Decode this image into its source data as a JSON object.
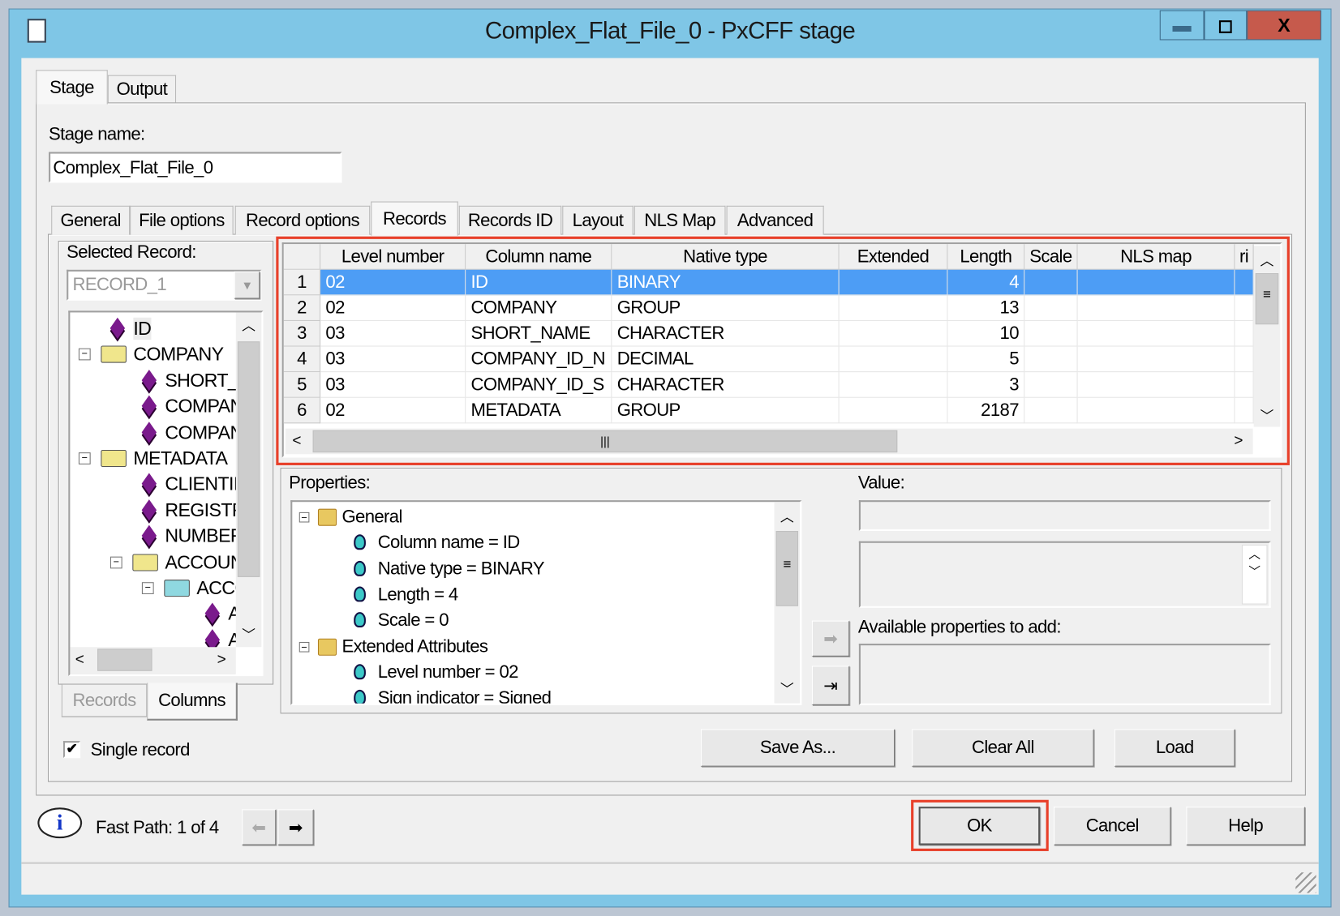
{
  "window": {
    "title": "Complex_Flat_File_0 - PxCFF stage",
    "minimize": "▬",
    "maximize": "◻",
    "close": "X"
  },
  "top_tabs": [
    {
      "label": "Stage",
      "selected": true
    },
    {
      "label": "Output",
      "selected": false
    }
  ],
  "stage_name": {
    "label": "Stage name:",
    "value": "Complex_Flat_File_0"
  },
  "inner_tabs": [
    {
      "label": "General"
    },
    {
      "label": "File options"
    },
    {
      "label": "Record options"
    },
    {
      "label": "Records",
      "selected": true
    },
    {
      "label": "Records ID"
    },
    {
      "label": "Layout"
    },
    {
      "label": "NLS Map"
    },
    {
      "label": "Advanced"
    }
  ],
  "left": {
    "selected_record_label": "Selected Record:",
    "selected_record_value": "RECORD_1",
    "tree": [
      {
        "label": "ID",
        "level": 0,
        "icon": "column-diamond-icon"
      },
      {
        "label": "COMPANY",
        "level": 0,
        "icon": "folder-icon",
        "expanded": true
      },
      {
        "label": "SHORT_",
        "level": 1,
        "icon": "column-diamond-icon"
      },
      {
        "label": "COMPAN",
        "level": 1,
        "icon": "column-diamond-icon"
      },
      {
        "label": "COMPAN",
        "level": 1,
        "icon": "column-diamond-icon"
      },
      {
        "label": "METADATA",
        "level": 0,
        "icon": "folder-icon",
        "expanded": true
      },
      {
        "label": "CLIENTII",
        "level": 1,
        "icon": "column-diamond-icon"
      },
      {
        "label": "REGISTF",
        "level": 1,
        "icon": "column-diamond-icon"
      },
      {
        "label": "NUMBEF",
        "level": 1,
        "icon": "column-diamond-icon"
      },
      {
        "label": "ACCOUN",
        "level": 1,
        "icon": "folder-icon",
        "expanded": true
      },
      {
        "label": "ACCC",
        "level": 2,
        "icon": "folder-cyan-icon",
        "expanded": true
      },
      {
        "label": "A",
        "level": 3,
        "icon": "column-diamond-icon"
      },
      {
        "label": "A",
        "level": 3,
        "icon": "column-diamond-icon"
      }
    ],
    "bottom_tabs": [
      {
        "label": "Records",
        "selected": false
      },
      {
        "label": "Columns",
        "selected": true
      }
    ],
    "single_record": {
      "label": "Single record",
      "checked": true
    }
  },
  "grid": {
    "columns": [
      "Level number",
      "Column name",
      "Native type",
      "Extended",
      "Length",
      "Scale",
      "NLS map",
      "ri"
    ],
    "rows": [
      {
        "n": "1",
        "level": "02",
        "name": "ID",
        "type": "BINARY",
        "extended": "",
        "length": "4",
        "scale": "",
        "nls": "",
        "selected": true
      },
      {
        "n": "2",
        "level": "02",
        "name": "COMPANY",
        "type": "GROUP",
        "extended": "",
        "length": "13",
        "scale": "",
        "nls": ""
      },
      {
        "n": "3",
        "level": "03",
        "name": "SHORT_NAME",
        "type": "CHARACTER",
        "extended": "",
        "length": "10",
        "scale": "",
        "nls": ""
      },
      {
        "n": "4",
        "level": "03",
        "name": "COMPANY_ID_N",
        "type": "DECIMAL",
        "extended": "",
        "length": "5",
        "scale": "",
        "nls": ""
      },
      {
        "n": "5",
        "level": "03",
        "name": "COMPANY_ID_S",
        "type": "CHARACTER",
        "extended": "",
        "length": "3",
        "scale": "",
        "nls": ""
      },
      {
        "n": "6",
        "level": "02",
        "name": "METADATA",
        "type": "GROUP",
        "extended": "",
        "length": "2187",
        "scale": "",
        "nls": ""
      }
    ]
  },
  "properties": {
    "label": "Properties:",
    "tree": [
      {
        "label": "General",
        "level": 0,
        "icon": "folder-icon"
      },
      {
        "label": "Column name = ID",
        "level": 1,
        "icon": "property-gem-icon"
      },
      {
        "label": "Native type = BINARY",
        "level": 1,
        "icon": "property-gem-icon"
      },
      {
        "label": "Length = 4",
        "level": 1,
        "icon": "property-gem-icon"
      },
      {
        "label": "Scale = 0",
        "level": 1,
        "icon": "property-gem-icon"
      },
      {
        "label": "Extended Attributes",
        "level": 0,
        "icon": "folder-icon"
      },
      {
        "label": "Level number = 02",
        "level": 1,
        "icon": "property-gem-icon"
      },
      {
        "label": "Sign indicator = Signed",
        "level": 1,
        "icon": "property-gem-icon"
      }
    ],
    "value_label": "Value:",
    "value": "",
    "available_label": "Available properties to add:"
  },
  "buttons": {
    "save_as": "Save As...",
    "clear_all": "Clear All",
    "load": "Load",
    "ok": "OK",
    "cancel": "Cancel",
    "help": "Help"
  },
  "fast_path": {
    "label": "Fast Path: 1 of 4"
  },
  "colors": {
    "highlight": "#e8402a",
    "selection": "#4d9df5",
    "title_bar": "#7fc6e6"
  }
}
